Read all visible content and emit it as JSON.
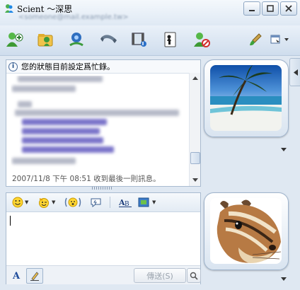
{
  "window": {
    "title": "Scient ～深思",
    "subtitle": "<someone@mail.example.tw>"
  },
  "status_banner": "您的狀態目前設定爲忙錄。",
  "conversation": {
    "last_message_info": "2007/11/8 下午 08:51 收到最後一則訊息。"
  },
  "composer": {
    "input_value": "",
    "send_label": "傳送(S)"
  },
  "icons": {
    "toolbar": [
      "invite-contact-icon",
      "share-files-icon",
      "video-call-icon",
      "voice-call-icon",
      "activities-icon",
      "games-icon",
      "block-icon",
      "paintbrush-icon",
      "menu-icon"
    ],
    "format": [
      "emoticon-icon",
      "wink-icon",
      "voice-clip-icon",
      "nudge-icon",
      "font-icon",
      "background-icon"
    ]
  },
  "colors": {
    "accent": "#2b6cb0",
    "frame": "#9fb4cd"
  }
}
